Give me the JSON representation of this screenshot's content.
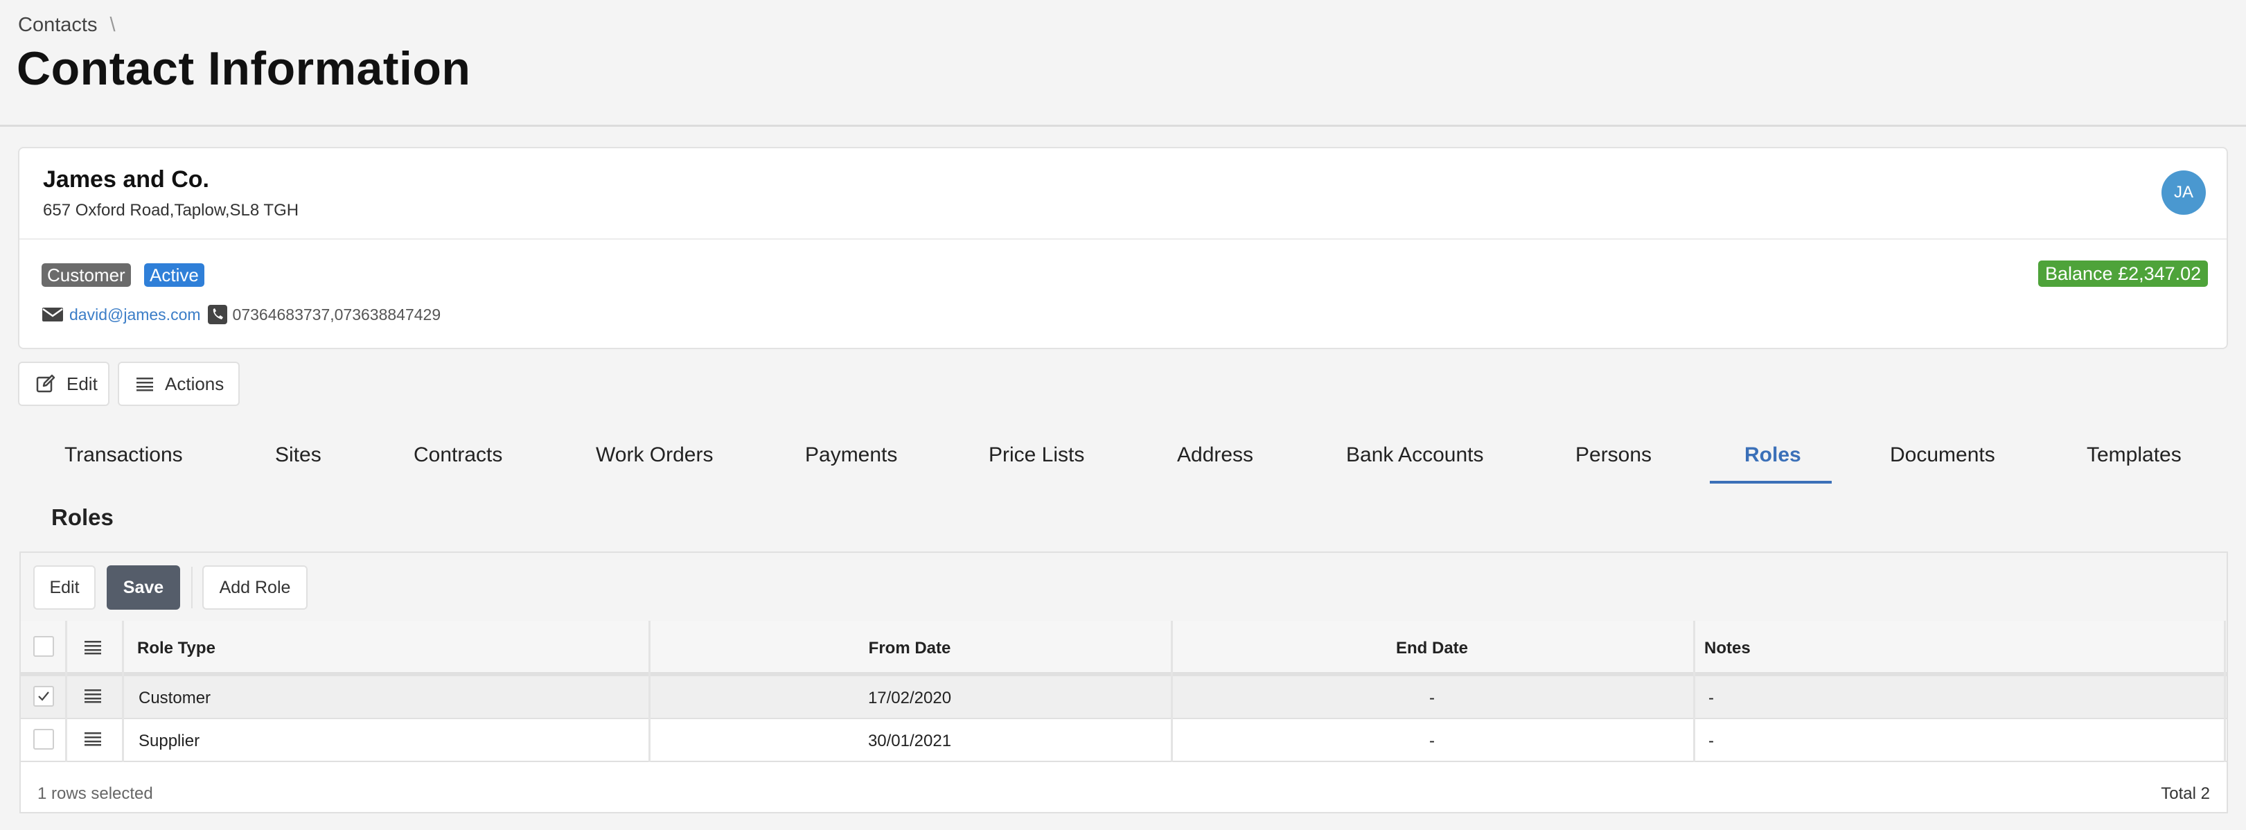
{
  "breadcrumb": {
    "root": "Contacts",
    "separator": "\\"
  },
  "page_title": "Contact Information",
  "contact": {
    "name": "James and Co.",
    "address": "657 Oxford Road,Taplow,SL8 TGH",
    "avatar_initials": "JA",
    "type_badge": "Customer",
    "status_badge": "Active",
    "balance": "Balance £2,347.02",
    "email": "david@james.com",
    "phones": "07364683737,073638847429"
  },
  "actions": {
    "edit_label": "Edit",
    "actions_label": "Actions"
  },
  "tabs": [
    {
      "label": "Transactions"
    },
    {
      "label": "Sites"
    },
    {
      "label": "Contracts"
    },
    {
      "label": "Work Orders"
    },
    {
      "label": "Payments"
    },
    {
      "label": "Price Lists"
    },
    {
      "label": "Address"
    },
    {
      "label": "Bank Accounts"
    },
    {
      "label": "Persons"
    },
    {
      "label": "Roles"
    },
    {
      "label": "Documents"
    },
    {
      "label": "Templates"
    }
  ],
  "active_tab": "Roles",
  "roles": {
    "heading": "Roles",
    "toolbar": {
      "edit_label": "Edit",
      "save_label": "Save",
      "add_label": "Add Role"
    },
    "columns": [
      "Role Type",
      "From Date",
      "End Date",
      "Notes"
    ],
    "rows": [
      {
        "role_type": "Customer",
        "from_date": "17/02/2020",
        "end_date": "-",
        "notes": "-",
        "checked": true
      },
      {
        "role_type": "Supplier",
        "from_date": "30/01/2021",
        "end_date": "-",
        "notes": "-",
        "checked": false
      }
    ],
    "selected_text": "1 rows selected",
    "total_text": "Total 2"
  },
  "colors": {
    "accent": "#3b70b8",
    "active_badge": "#2f7fd8",
    "customer_badge": "#6b6b6b",
    "balance_badge": "#4ea33a",
    "avatar": "#4a98d0",
    "save_button": "#555d6a"
  },
  "icons": {
    "edit": "pencil-square-icon",
    "actions": "menu-lines-icon",
    "email": "envelope-icon",
    "phone": "phone-icon",
    "row_menu": "menu-lines-icon",
    "check": "check-icon"
  }
}
